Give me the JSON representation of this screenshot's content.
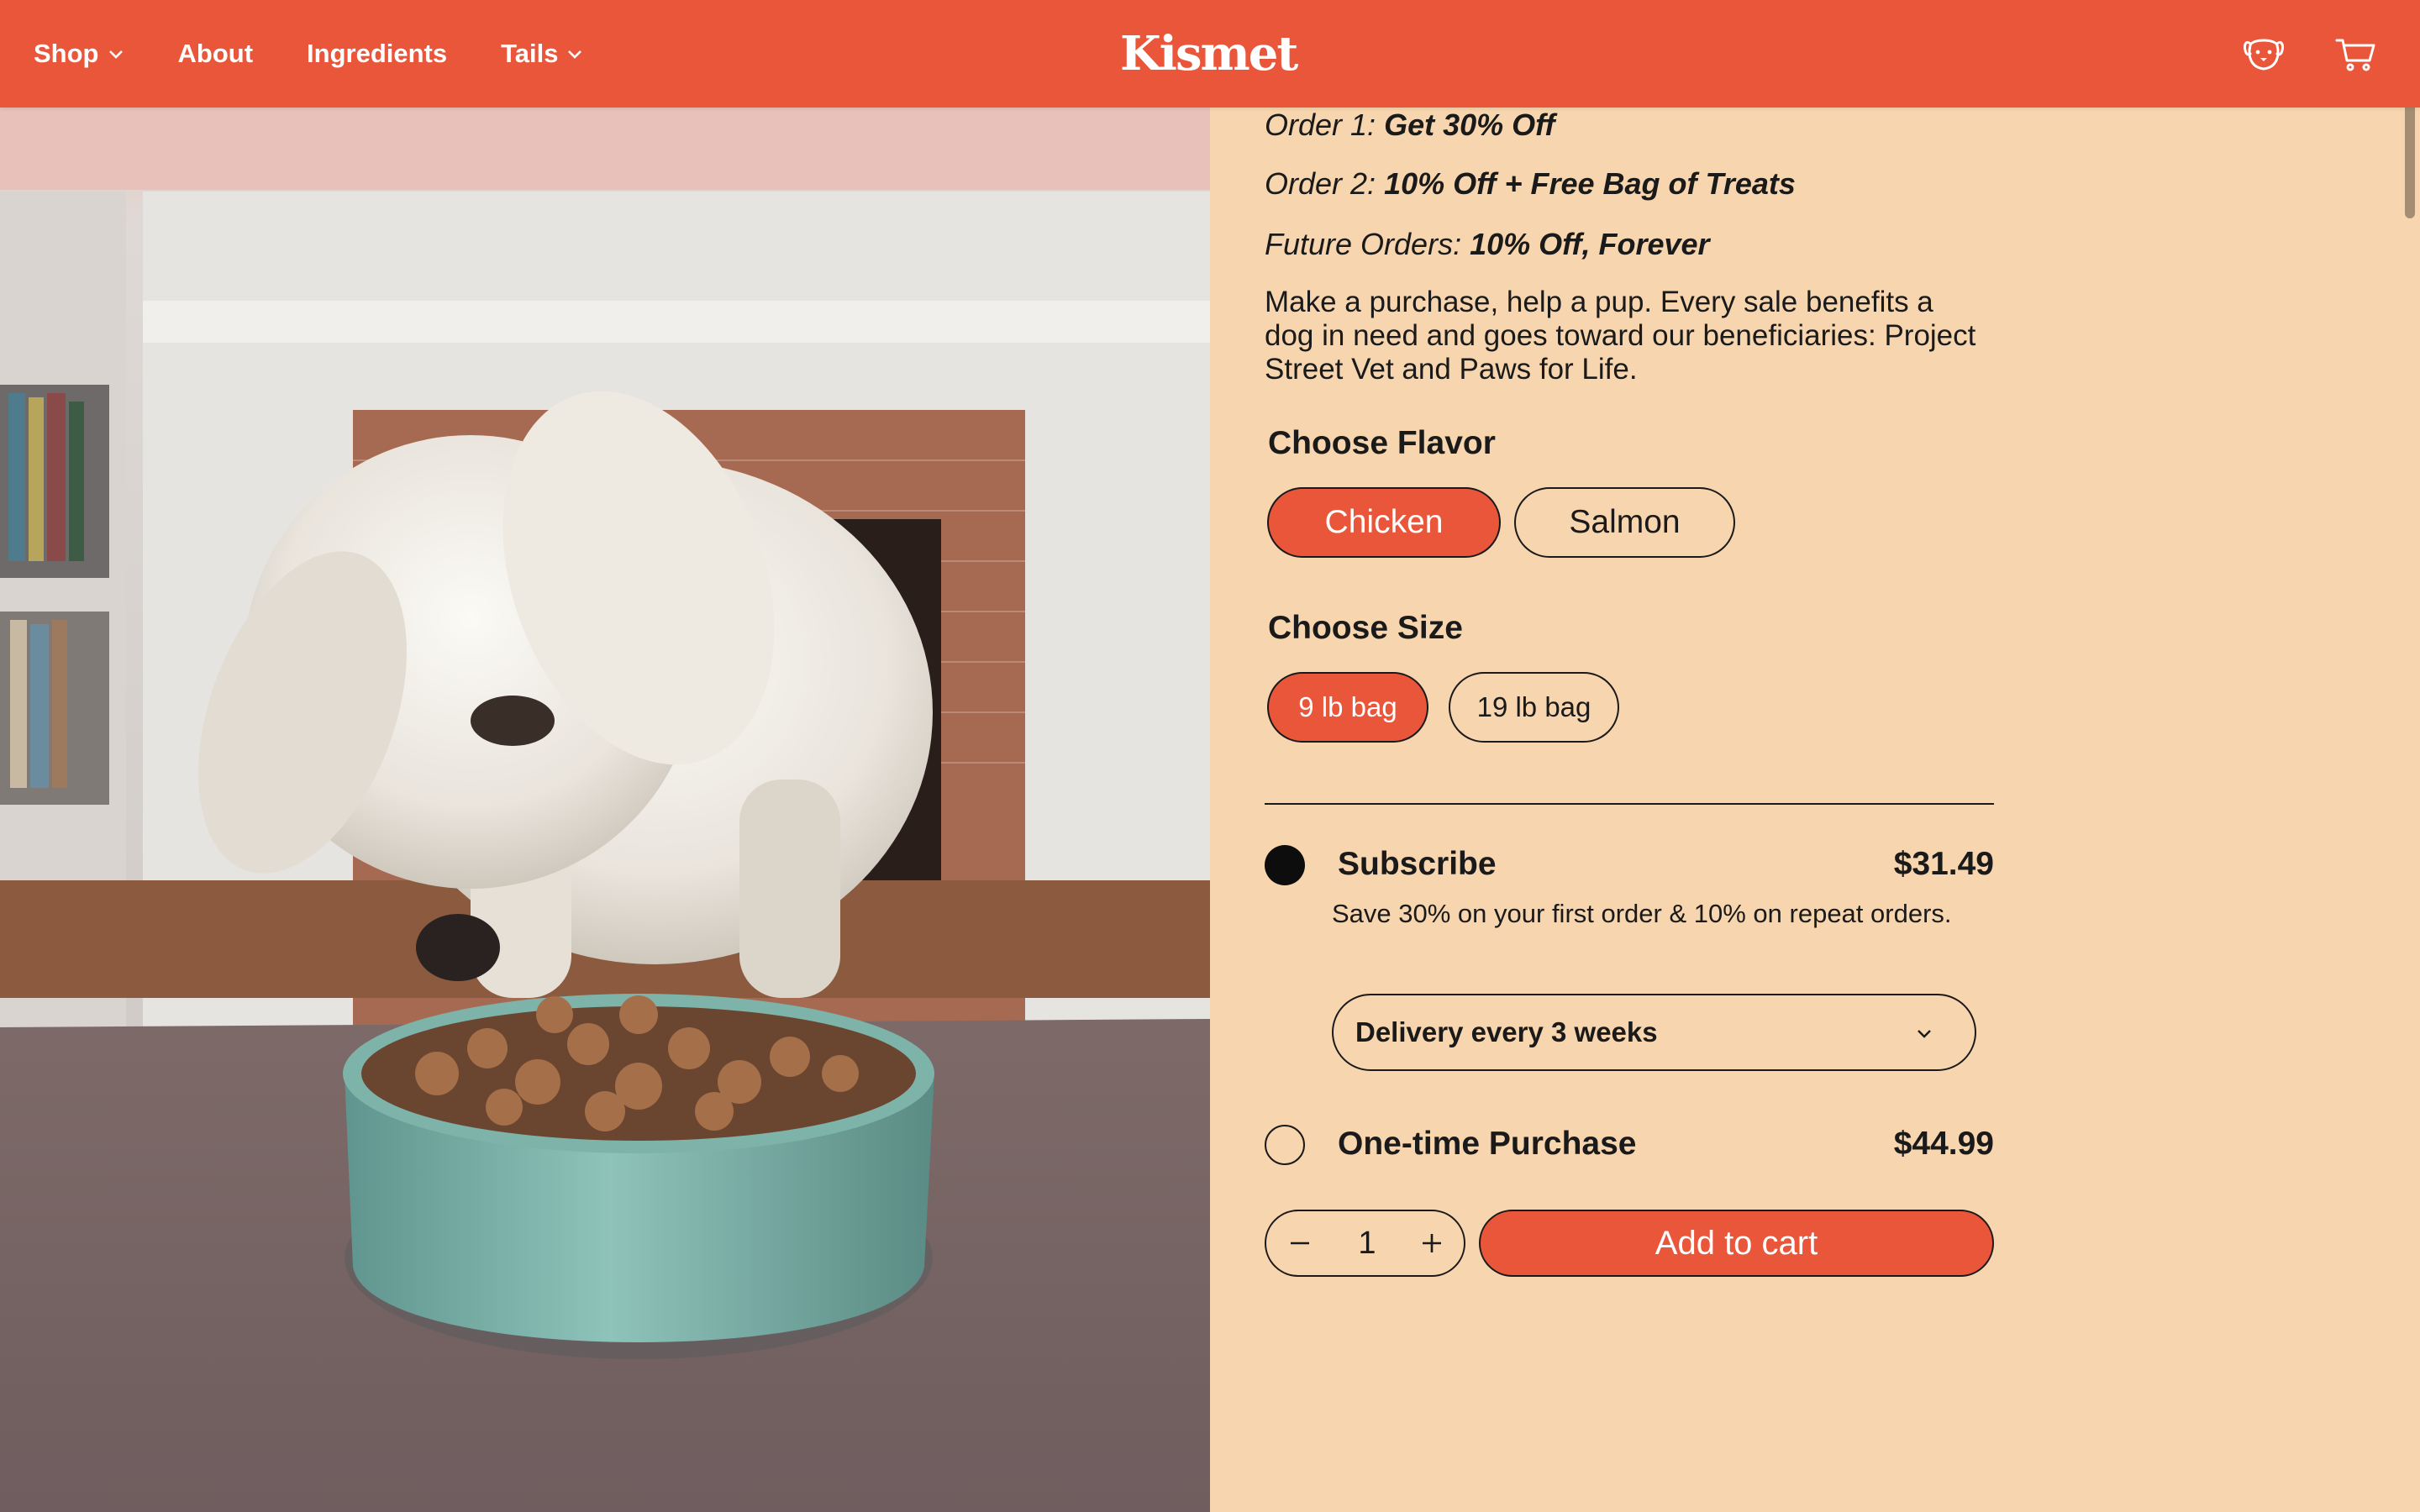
{
  "colors": {
    "brand": "#ea563a",
    "panel_bg": "#f7d5ae",
    "text": "#1a1a1a"
  },
  "header": {
    "nav": [
      {
        "label": "Shop",
        "has_dropdown": true
      },
      {
        "label": "About",
        "has_dropdown": false
      },
      {
        "label": "Ingredients",
        "has_dropdown": false
      },
      {
        "label": "Tails",
        "has_dropdown": true
      }
    ],
    "brand": "Kismet",
    "icons": [
      "dog-account-icon",
      "cart-icon"
    ]
  },
  "offers": [
    {
      "prefix": "Order 1:",
      "deal": "Get 30% Off"
    },
    {
      "prefix": "Order 2:",
      "deal": "10% Off + Free Bag of Treats"
    },
    {
      "prefix": "Future Orders:",
      "deal": "10% Off, Forever"
    }
  ],
  "blurb": "Make a purchase, help a pup. Every sale benefits a dog in need and goes toward our beneficiaries: Project Street Vet and Paws for Life.",
  "flavor": {
    "title": "Choose Flavor",
    "options": [
      "Chicken",
      "Salmon"
    ],
    "selected": "Chicken"
  },
  "size": {
    "title": "Choose Size",
    "options": [
      "9 lb bag",
      "19 lb bag"
    ],
    "selected": "9 lb bag"
  },
  "purchase": {
    "subscribe": {
      "label": "Subscribe",
      "price": "$31.49",
      "description": "Save 30% on your first order & 10% on repeat orders.",
      "selected": true,
      "delivery": "Delivery every 3 weeks"
    },
    "one_time": {
      "label": "One-time Purchase",
      "price": "$44.99",
      "selected": false
    }
  },
  "cart": {
    "quantity": "1",
    "add_label": "Add to cart"
  }
}
